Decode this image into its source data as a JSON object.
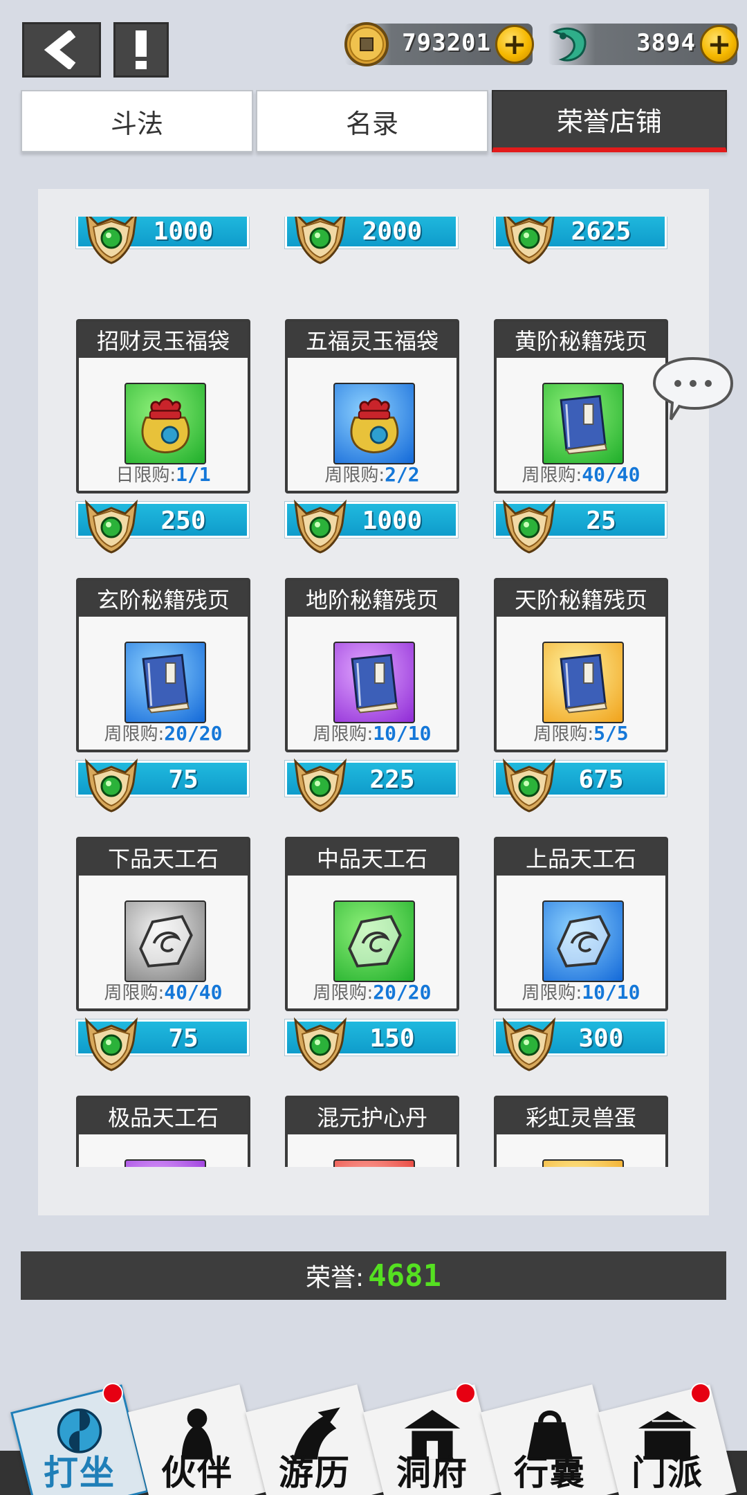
{
  "header": {
    "coins": "793201",
    "jade": "3894",
    "plus_label": "+"
  },
  "tabs": [
    {
      "label": "斗法",
      "active": false
    },
    {
      "label": "名录",
      "active": false
    },
    {
      "label": "荣誉店铺",
      "active": true
    }
  ],
  "shop": {
    "top_prices": [
      "1000",
      "2000",
      "2625"
    ],
    "items": [
      {
        "name": "招财灵玉福袋",
        "limit_label": "日限购:",
        "limit": "1/1",
        "price": "250",
        "icon": "fortune-bag-icon",
        "bg": "green"
      },
      {
        "name": "五福灵玉福袋",
        "limit_label": "周限购:",
        "limit": "2/2",
        "price": "1000",
        "icon": "fortune-bag-icon",
        "bg": "blue"
      },
      {
        "name": "黄阶秘籍残页",
        "limit_label": "周限购:",
        "limit": "40/40",
        "price": "25",
        "icon": "manual-book-icon",
        "bg": "green"
      },
      {
        "name": "玄阶秘籍残页",
        "limit_label": "周限购:",
        "limit": "20/20",
        "price": "75",
        "icon": "manual-book-icon",
        "bg": "blue"
      },
      {
        "name": "地阶秘籍残页",
        "limit_label": "周限购:",
        "limit": "10/10",
        "price": "225",
        "icon": "manual-book-icon",
        "bg": "purple"
      },
      {
        "name": "天阶秘籍残页",
        "limit_label": "周限购:",
        "limit": "5/5",
        "price": "675",
        "icon": "manual-book-icon",
        "bg": "gold"
      },
      {
        "name": "下品天工石",
        "limit_label": "周限购:",
        "limit": "40/40",
        "price": "75",
        "icon": "craft-stone-icon",
        "bg": "gray"
      },
      {
        "name": "中品天工石",
        "limit_label": "周限购:",
        "limit": "20/20",
        "price": "150",
        "icon": "craft-stone-icon",
        "bg": "green"
      },
      {
        "name": "上品天工石",
        "limit_label": "周限购:",
        "limit": "10/10",
        "price": "300",
        "icon": "craft-stone-icon",
        "bg": "blue"
      },
      {
        "name": "极品天工石",
        "limit_label": "",
        "limit": "",
        "price": "",
        "icon": "craft-stone-icon",
        "bg": "purple"
      },
      {
        "name": "混元护心丹",
        "limit_label": "",
        "limit": "",
        "price": "",
        "icon": "elixir-pill-icon",
        "bg": "red"
      },
      {
        "name": "彩虹灵兽蛋",
        "limit_label": "",
        "limit": "",
        "price": "",
        "icon": "beast-egg-icon",
        "bg": "gold"
      }
    ]
  },
  "honor": {
    "label": "荣誉:",
    "value": "4681"
  },
  "nav": [
    {
      "label": "打坐",
      "badge": true
    },
    {
      "label": "伙伴",
      "badge": false
    },
    {
      "label": "游历",
      "badge": false
    },
    {
      "label": "洞府",
      "badge": true
    },
    {
      "label": "行囊",
      "badge": false
    },
    {
      "label": "门派",
      "badge": true
    }
  ],
  "colors": {
    "accent_blue": "#15a8d6",
    "honor_green": "#55e021",
    "badge_red": "#e60012",
    "limit_blue": "#1477d8"
  }
}
